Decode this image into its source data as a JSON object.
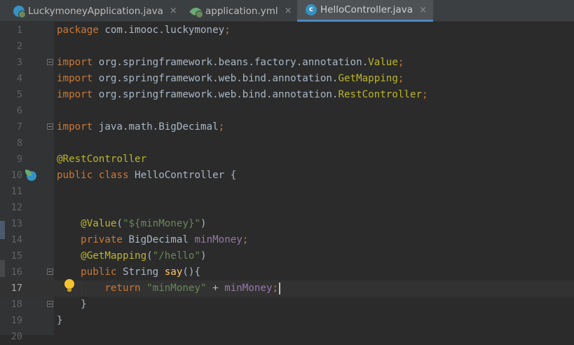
{
  "tabs": [
    {
      "label": "LuckymoneyApplication.java",
      "close": "×",
      "active": false,
      "icon": "spring-app-class-icon"
    },
    {
      "label": "application.yml",
      "close": "×",
      "active": false,
      "icon": "spring-yml-leaf-icon"
    },
    {
      "label": "HelloController.java",
      "close": "×",
      "active": true,
      "icon": "class-c-icon",
      "icon_letter": "c"
    }
  ],
  "editor": {
    "current_line": 17,
    "lines": [
      {
        "n": "1",
        "tokens": [
          {
            "t": "package ",
            "c": "kw"
          },
          {
            "t": "com.imooc.luckymoney",
            "c": ""
          },
          {
            "t": ";",
            "c": "kw"
          }
        ]
      },
      {
        "n": "2",
        "tokens": []
      },
      {
        "n": "3",
        "tokens": [
          {
            "t": "import ",
            "c": "kw"
          },
          {
            "t": "org.springframework.beans.factory.annotation.",
            "c": ""
          },
          {
            "t": "Value",
            "c": "an"
          },
          {
            "t": ";",
            "c": "kw"
          }
        ]
      },
      {
        "n": "4",
        "tokens": [
          {
            "t": "import ",
            "c": "kw"
          },
          {
            "t": "org.springframework.web.bind.annotation.",
            "c": ""
          },
          {
            "t": "GetMapping",
            "c": "an"
          },
          {
            "t": ";",
            "c": "kw"
          }
        ]
      },
      {
        "n": "5",
        "tokens": [
          {
            "t": "import ",
            "c": "kw"
          },
          {
            "t": "org.springframework.web.bind.annotation.",
            "c": ""
          },
          {
            "t": "RestController",
            "c": "an"
          },
          {
            "t": ";",
            "c": "kw"
          }
        ]
      },
      {
        "n": "6",
        "tokens": []
      },
      {
        "n": "7",
        "tokens": [
          {
            "t": "import ",
            "c": "kw"
          },
          {
            "t": "java.math.BigDecimal",
            "c": ""
          },
          {
            "t": ";",
            "c": "kw"
          }
        ]
      },
      {
        "n": "8",
        "tokens": []
      },
      {
        "n": "9",
        "tokens": [
          {
            "t": "@RestController",
            "c": "an"
          }
        ]
      },
      {
        "n": "10",
        "tokens": [
          {
            "t": "public class ",
            "c": "kw"
          },
          {
            "t": "HelloController {",
            "c": ""
          }
        ]
      },
      {
        "n": "11",
        "tokens": []
      },
      {
        "n": "12",
        "tokens": []
      },
      {
        "n": "13",
        "tokens": [
          {
            "t": "    ",
            "c": ""
          },
          {
            "t": "@Value",
            "c": "an"
          },
          {
            "t": "(",
            "c": ""
          },
          {
            "t": "\"${minMoney}\"",
            "c": "st"
          },
          {
            "t": ")",
            "c": ""
          }
        ]
      },
      {
        "n": "14",
        "tokens": [
          {
            "t": "    ",
            "c": ""
          },
          {
            "t": "private ",
            "c": "kw"
          },
          {
            "t": "BigDecimal ",
            "c": ""
          },
          {
            "t": "minMoney",
            "c": "fd"
          },
          {
            "t": ";",
            "c": "kw"
          }
        ]
      },
      {
        "n": "15",
        "tokens": [
          {
            "t": "    ",
            "c": ""
          },
          {
            "t": "@GetMapping",
            "c": "an"
          },
          {
            "t": "(",
            "c": ""
          },
          {
            "t": "\"/hello\"",
            "c": "st"
          },
          {
            "t": ")",
            "c": ""
          }
        ]
      },
      {
        "n": "16",
        "tokens": [
          {
            "t": "    ",
            "c": ""
          },
          {
            "t": "public ",
            "c": "kw"
          },
          {
            "t": "String ",
            "c": ""
          },
          {
            "t": "say",
            "c": "fn"
          },
          {
            "t": "(){",
            "c": ""
          }
        ]
      },
      {
        "n": "17",
        "tokens": [
          {
            "t": "        ",
            "c": ""
          },
          {
            "t": "return ",
            "c": "kw"
          },
          {
            "t": "\"minMoney\"",
            "c": "st"
          },
          {
            "t": " + ",
            "c": ""
          },
          {
            "t": "minMoney",
            "c": "fd"
          },
          {
            "t": ";",
            "c": "kw"
          }
        ]
      },
      {
        "n": "18",
        "tokens": [
          {
            "t": "    }",
            "c": ""
          }
        ]
      },
      {
        "n": "19",
        "tokens": [
          {
            "t": "}",
            "c": ""
          }
        ]
      },
      {
        "n": "20",
        "tokens": []
      }
    ]
  },
  "colors": {
    "keyword": "#cc7832",
    "annotation": "#bbb529",
    "string": "#6a8759",
    "field": "#9876aa",
    "method": "#ffc66d",
    "plain": "#a9b7c6",
    "active_tab_underline": "#4a88c7"
  }
}
